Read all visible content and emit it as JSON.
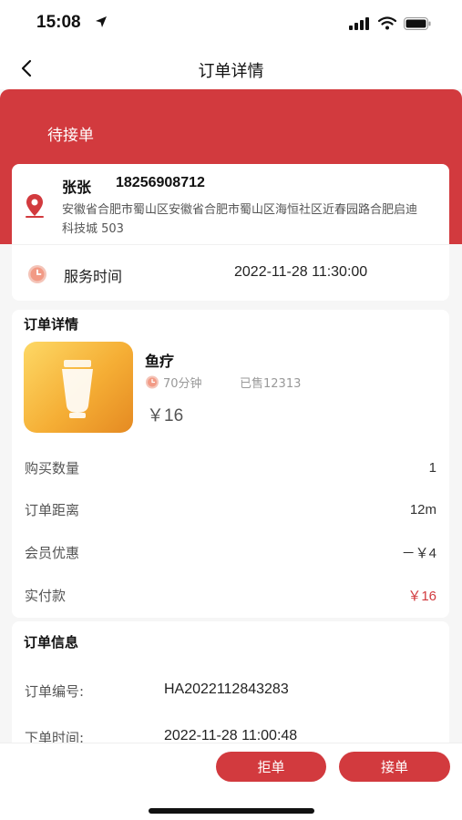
{
  "status_bar": {
    "time": "15:08"
  },
  "nav": {
    "title": "订单详情"
  },
  "order_status": "待接单",
  "customer": {
    "name": "张张",
    "phone": "18256908712",
    "address": "安徽省合肥市蜀山区安徽省合肥市蜀山区海恒社区近春园路合肥启迪科技城 503"
  },
  "service_time": {
    "label": "服务时间",
    "value": "2022-11-28 11:30:00"
  },
  "order_detail": {
    "title": "订单详情",
    "product": {
      "name": "鱼疗",
      "duration": "70分钟",
      "sold": "已售12313",
      "price": "￥16"
    },
    "rows": [
      {
        "label": "购买数量",
        "value": "1"
      },
      {
        "label": "订单距离",
        "value": "12m"
      },
      {
        "label": "会员优惠",
        "value": "－￥4"
      },
      {
        "label": "实付款",
        "value": "￥16"
      }
    ]
  },
  "order_info": {
    "title": "订单信息",
    "number_label": "订单编号:",
    "number_value": "HA2022112843283",
    "time_label": "下单时间:",
    "time_value": "2022-11-28 11:00:48"
  },
  "actions": {
    "reject": "拒单",
    "accept": "接单"
  },
  "colors": {
    "accent": "#d23a3e",
    "page_bg": "#f6f6f6",
    "product_gradient_start": "#fdd865",
    "product_gradient_end": "#e58a22"
  },
  "icons": {
    "location": "location-pin-icon",
    "clock": "clock-icon",
    "back": "back-chevron-icon"
  }
}
